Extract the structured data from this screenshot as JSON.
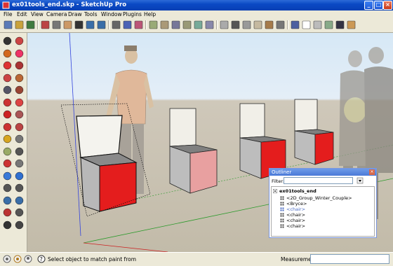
{
  "window": {
    "title": "ex01tools_end.skp - SketchUp Pro",
    "minimize": "_",
    "maximize": "□",
    "close": "×"
  },
  "menu": [
    "File",
    "Edit",
    "View",
    "Camera",
    "Draw",
    "Tools",
    "Window",
    "Plugins",
    "Help"
  ],
  "toolbar_icons": [
    "new-icon",
    "open-icon",
    "save-icon",
    "cut-icon",
    "copy-icon",
    "paste-icon",
    "erase-icon",
    "undo-icon",
    "redo-icon",
    "print-icon",
    "model-info-icon",
    "iso-view-icon",
    "top-view-icon",
    "front-view-icon",
    "right-view-icon",
    "back-view-icon",
    "left-view-icon",
    "xray-icon",
    "back-edges-icon",
    "wireframe-icon",
    "hidden-line-icon",
    "shaded-icon",
    "textured-icon",
    "monochrome-icon",
    "component-1-icon",
    "component-2-icon",
    "component-3-icon",
    "component-4-icon",
    "component-5-icon",
    "component-6-icon"
  ],
  "left_tools": [
    "select-icon",
    "make-component-icon",
    "paint-bucket-icon",
    "eraser-icon",
    "rectangle-icon",
    "line-icon",
    "circle-icon",
    "arc-icon",
    "polygon-icon",
    "freehand-icon",
    "move-icon",
    "push-pull-icon",
    "rotate-icon",
    "follow-me-icon",
    "scale-icon",
    "offset-icon",
    "tape-measure-icon",
    "dimension-icon",
    "protractor-icon",
    "text-icon",
    "axes-icon",
    "3d-text-icon",
    "orbit-icon",
    "pan-icon",
    "zoom-icon",
    "zoom-window-icon",
    "zoom-extents-icon",
    "previous-icon",
    "position-camera-icon",
    "look-around-icon",
    "walk-icon",
    "section-plane-icon"
  ],
  "outliner": {
    "title": "Outliner",
    "filter_label": "Filter:",
    "filter_value": "",
    "root": "ex01tools_end",
    "items": [
      {
        "label": "<2D_Group_Winter_Couple>",
        "selected": false
      },
      {
        "label": "<Bryce>",
        "selected": false
      },
      {
        "label": "<chair>",
        "selected": true
      },
      {
        "label": "<chair>",
        "selected": false
      },
      {
        "label": "<chair>",
        "selected": false
      },
      {
        "label": "<chair>",
        "selected": false
      }
    ]
  },
  "status": {
    "text": "Select object to match paint from",
    "measurements_label": "Measurements",
    "measurements_value": ""
  },
  "colors": {
    "seat_red": "#e41d1d",
    "chair_gray": "#a9a9a9",
    "chair_back": "#f0efe9",
    "title_blue": "#0a49c4"
  }
}
